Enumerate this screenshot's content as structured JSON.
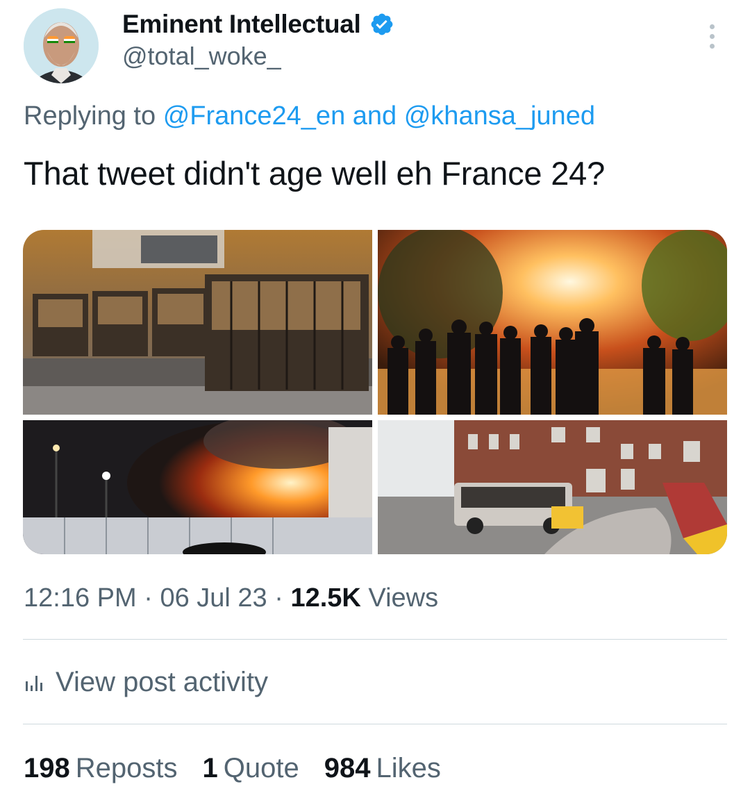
{
  "author": {
    "display_name": "Eminent Intellectual",
    "handle": "@total_woke_",
    "verified_icon": "verified-badge-icon",
    "avatar_icon": "avatar"
  },
  "reply": {
    "prefix": "Replying to",
    "mention_1": "@France24_en",
    "joiner": "and",
    "mention_2": "@khansa_juned"
  },
  "tweet": {
    "text": "That tweet didn't age well eh France 24?"
  },
  "media": {
    "images": [
      "burned-buses-photo",
      "fireworks-police-photo",
      "fire-at-night-photo",
      "burned-cars-street-photo"
    ]
  },
  "meta": {
    "time": "12:16 PM",
    "sep1": "·",
    "date": "06 Jul 23",
    "sep2": "·",
    "views_count": "12.5K",
    "views_label": "Views"
  },
  "activity": {
    "icon": "analytics-icon",
    "label": "View post activity"
  },
  "stats": {
    "reposts_count": "198",
    "reposts_label": "Reposts",
    "quotes_count": "1",
    "quotes_label": "Quote",
    "likes_count": "984",
    "likes_label": "Likes"
  },
  "colors": {
    "text": "#0f1419",
    "secondary": "#536471",
    "link": "#1d9bf0",
    "divider": "#cfd9de"
  }
}
